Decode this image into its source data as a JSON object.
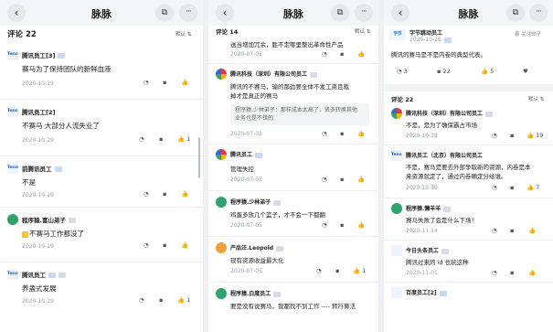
{
  "nav": {
    "back_icon": "‹",
    "title": "脉脉",
    "share_icon": "⧉",
    "more_icon": "···"
  },
  "panel1": {
    "comment_count": "评论 22",
    "sort_label": "默认 ⇅",
    "comments": [
      {
        "name": "腾讯员工[3]",
        "text": "赛马为了保持团队的新鲜血液",
        "date": "2020-10-29",
        "likes": ""
      },
      {
        "name": "腾讯员工[2]",
        "text": "不赛马 大部分人流失业了",
        "date": "2020-10-29",
        "likes": "1"
      },
      {
        "name": "前腾讯员工",
        "text": "不是",
        "date": "2020-10-29",
        "likes": ""
      },
      {
        "name": "程序猿.富山弟子",
        "text": "不赛马工作都没了",
        "date": "2020-10-29",
        "likes": ""
      },
      {
        "name": "腾讯员工",
        "text": "养蛊式发展",
        "date": "2020-10-29",
        "likes": "1"
      }
    ]
  },
  "panel2": {
    "comment_count": "评论 14",
    "sort_label": "默认 ⇅",
    "top_text": "送当增加冗余，胜不定哪里整出革命性产品",
    "top_date": "2020-07-05",
    "comments": [
      {
        "name": "腾讯科技（深圳）有限公司员工",
        "text1": "腾讯的不赛马，输的那边要全体不发工资且裁",
        "text2": "掉才是真正的赛马",
        "quote1": "程序猿.少林弟子：那样成本太高了，贤多转换其他",
        "quote2": "业务也是不错的",
        "date": "2020-07-03",
        "likes": ""
      },
      {
        "name": "腾讯员工",
        "text": "管理失控",
        "date": "2020-07-03",
        "likes": ""
      },
      {
        "name": "程序猿.少林弟子",
        "text": "鸡蛋多放几个篮子，才不会一下都翻",
        "date": "2020-07-05",
        "likes": ""
      },
      {
        "name": "产品汪.Leopold",
        "text": "现有资源收益最大化",
        "date": "2020-07-05",
        "likes": "1"
      },
      {
        "name": "程序猿.白度员工",
        "text": "要是没有说赛马，我都找不到工作 ---- 转行算法",
        "date": "",
        "likes": ""
      }
    ]
  },
  "panel3": {
    "top": {
      "name": "字节跳动员工",
      "date": "2020-10-26",
      "tag": "春 关注帖子",
      "text": "腾讯的赛马是不是内卷的典型代表。",
      "comment_count": "3",
      "reply_count": "22",
      "like_count": "5"
    },
    "comment_count": "评论 22",
    "sort_label": "默认 ⇅",
    "comments": [
      {
        "name": "腾讯科技（深圳）有限公司员工",
        "text": "不是，是为了确保霸占市场",
        "date": "2020-10-28",
        "likes": "19"
      },
      {
        "name": "腾讯员工（北京）有限公司员工",
        "text1": "不是，赛马是要去外部争取新的资源，内卷是本",
        "text2": "来资源就定了，通过内卷确定分给谁。",
        "date": "2020-10-30",
        "likes": "7"
      },
      {
        "name": "程序猿.懒羊羊",
        "text": "赛马失败了会是什么下场?",
        "date": "2020-11-14",
        "likes": ""
      },
      {
        "name": "今日头条员工",
        "text": "腾讯过来的 id 也玩这种",
        "date": "2020-11-01",
        "likes": ""
      },
      {
        "name": "百度员工[2]",
        "text": "",
        "date": "",
        "likes": ""
      }
    ]
  },
  "icons": {
    "comment": "◔",
    "reply": "▪",
    "like": "👍",
    "heart": "♥",
    "logo_tencent": "Tencent",
    "logo_bytedance": "字节"
  }
}
